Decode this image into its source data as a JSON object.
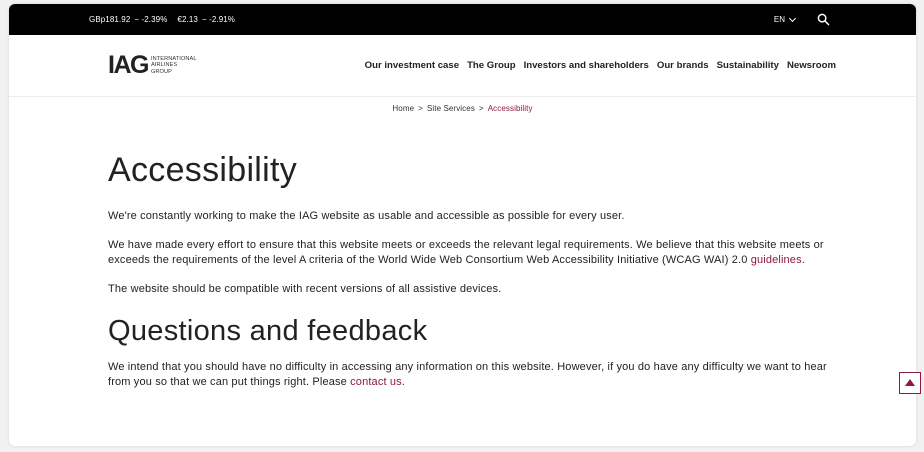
{
  "topbar": {
    "ticker": [
      {
        "price": "GBp181.92",
        "change": "− -2.39%"
      },
      {
        "price": "€2.13",
        "change": "− -2.91%"
      }
    ],
    "language": "EN"
  },
  "logo": {
    "mark": "IAG",
    "line1": "INTERNATIONAL",
    "line2": "AIRLINES",
    "line3": "GROUP"
  },
  "nav": [
    "Our investment case",
    "The Group",
    "Investors and shareholders",
    "Our brands",
    "Sustainability",
    "Newsroom"
  ],
  "breadcrumb": {
    "home": "Home",
    "section": "Site Services",
    "current": "Accessibility",
    "separator": ">"
  },
  "main": {
    "title": "Accessibility",
    "p1": "We're constantly working to make the IAG website as usable and accessible as possible for every user.",
    "p2_text": "We have made every effort to ensure that this website meets or exceeds the relevant legal requirements. We believe that this website meets or exceeds the requirements of the level A criteria of the World Wide Web Consortium Web Accessibility Initiative (WCAG WAI) 2.0 ",
    "p2_link": "guidelines",
    "p2_end": ".",
    "p3": "The website should be compatible with recent versions of all assistive devices.",
    "heading2": "Questions and feedback",
    "p4_text": "We intend that you should have no difficulty in accessing any information on this website. However, if you do have any difficulty we want to hear from you so that we can put things right. Please ",
    "p4_link": "contact us",
    "p4_end": "."
  },
  "colors": {
    "accent": "#8b1a40",
    "topbar_bg": "#000000",
    "page_bg": "#ffffff"
  },
  "icons": {
    "search": "search-icon",
    "language_chevron": "chevron-down-icon",
    "back_to_top": "arrow-up-icon"
  }
}
